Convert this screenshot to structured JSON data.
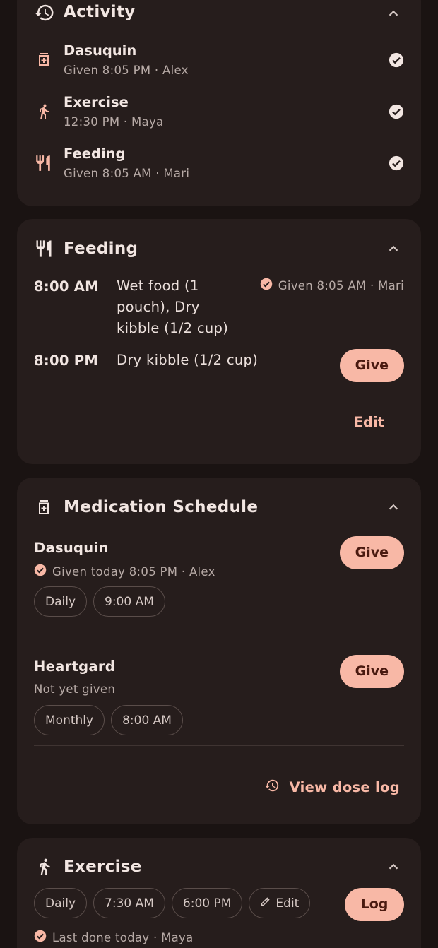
{
  "activity": {
    "title": "Activity",
    "items": [
      {
        "icon": "medication-icon",
        "title": "Dasuquin",
        "subtitle": "Given 8:05 PM · Alex"
      },
      {
        "icon": "walk-icon",
        "title": "Exercise",
        "subtitle": "12:30 PM · Maya"
      },
      {
        "icon": "restaurant-icon",
        "title": "Feeding",
        "subtitle": "Given 8:05 AM · Mari"
      }
    ]
  },
  "feeding": {
    "title": "Feeding",
    "rows": [
      {
        "time": "8:00 AM",
        "desc_lines": [
          "Wet food (1",
          "pouch), Dry",
          "kibble (1/2 cup)"
        ],
        "status": "Given 8:05 AM · Mari"
      },
      {
        "time": "8:00 PM",
        "desc_lines": [
          "Dry kibble (1/2 cup)"
        ],
        "button": "Give"
      }
    ],
    "edit_label": "Edit"
  },
  "medication": {
    "title": "Medication Schedule",
    "items": [
      {
        "name": "Dasuquin",
        "status": "Given today 8:05 PM · Alex",
        "chips": [
          "Daily",
          "9:00 AM"
        ],
        "button": "Give"
      },
      {
        "name": "Heartgard",
        "status": "Not yet given",
        "chips": [
          "Monthly",
          "8:00 AM"
        ],
        "button": "Give"
      }
    ],
    "view_log_label": "View dose log"
  },
  "exercise": {
    "title": "Exercise",
    "chips": [
      "Daily",
      "7:30 AM",
      "6:00 PM"
    ],
    "edit_chip": "Edit",
    "button": "Log",
    "status": "Last done today · Maya"
  },
  "colors": {
    "background": "#1a1312",
    "card": "#261d1c",
    "accent": "#f8b8a6",
    "on_accent": "#4a1a10",
    "muted_text": "#b7aaa6"
  }
}
